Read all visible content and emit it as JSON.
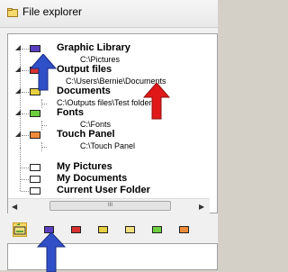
{
  "window": {
    "title": "File explorer",
    "icon": "folder-app-icon"
  },
  "tree": [
    {
      "name": "Graphic Library",
      "path": "C:\\Pictures",
      "folder_color": "#5a3fc0"
    },
    {
      "name": "Output files",
      "path": "C:\\Users\\Bernie\\Documents",
      "folder_color": "#d83030"
    },
    {
      "name": "Documents",
      "path": "C:\\Outputs files\\Test folder",
      "folder_color": "#e8d040"
    },
    {
      "name": "Fonts",
      "path": "C:\\Fonts",
      "folder_color": "#6ccf40"
    },
    {
      "name": "Touch Panel",
      "path": "C:\\Touch Panel",
      "folder_color": "#f08a3a"
    },
    {
      "name": "My Pictures",
      "path": "",
      "folder_color": "#ffffff"
    },
    {
      "name": "My Documents",
      "path": "",
      "folder_color": "#ffffff"
    },
    {
      "name": "Current User Folder",
      "path": "",
      "folder_color": "#ffffff"
    }
  ],
  "scrollbar": {
    "thumb_label": "III"
  },
  "toolbar": {
    "buttons": [
      {
        "name": "up-folder-icon",
        "color": "#2a8a2a"
      },
      {
        "name": "purple-folder-icon",
        "color": "#5a3fc0"
      },
      {
        "name": "red-folder-icon",
        "color": "#d83030"
      },
      {
        "name": "yellow-folder-icon",
        "color": "#e8d040"
      },
      {
        "name": "light-yellow-folder-icon",
        "color": "#f0e080"
      },
      {
        "name": "green-folder-icon",
        "color": "#6ccf40"
      },
      {
        "name": "orange-folder-icon",
        "color": "#f08a3a"
      }
    ]
  },
  "annotations": {
    "blue_arrow_color": "#3050c8",
    "red_arrow_color": "#e01818"
  }
}
